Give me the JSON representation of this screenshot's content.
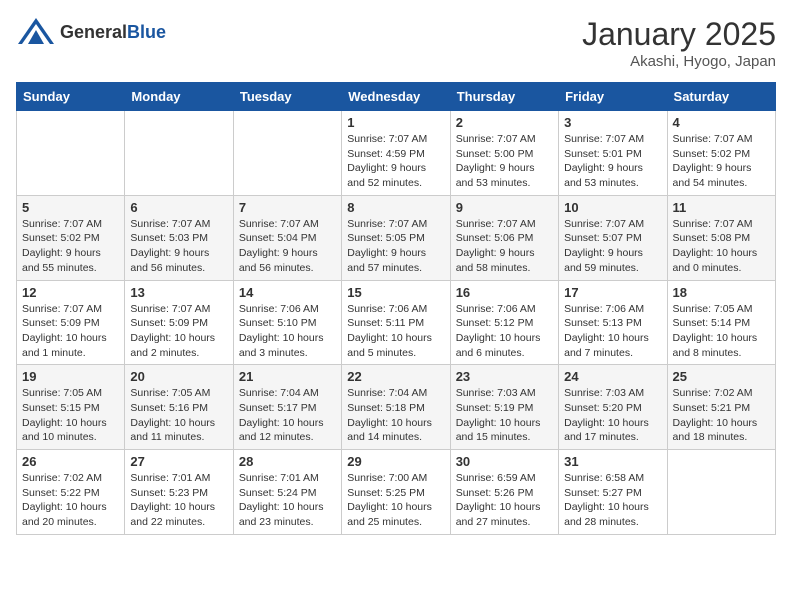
{
  "logo": {
    "general": "General",
    "blue": "Blue"
  },
  "title": "January 2025",
  "subtitle": "Akashi, Hyogo, Japan",
  "days_of_week": [
    "Sunday",
    "Monday",
    "Tuesday",
    "Wednesday",
    "Thursday",
    "Friday",
    "Saturday"
  ],
  "weeks": [
    [
      {
        "day": "",
        "info": ""
      },
      {
        "day": "",
        "info": ""
      },
      {
        "day": "",
        "info": ""
      },
      {
        "day": "1",
        "info": "Sunrise: 7:07 AM\nSunset: 4:59 PM\nDaylight: 9 hours\nand 52 minutes."
      },
      {
        "day": "2",
        "info": "Sunrise: 7:07 AM\nSunset: 5:00 PM\nDaylight: 9 hours\nand 53 minutes."
      },
      {
        "day": "3",
        "info": "Sunrise: 7:07 AM\nSunset: 5:01 PM\nDaylight: 9 hours\nand 53 minutes."
      },
      {
        "day": "4",
        "info": "Sunrise: 7:07 AM\nSunset: 5:02 PM\nDaylight: 9 hours\nand 54 minutes."
      }
    ],
    [
      {
        "day": "5",
        "info": "Sunrise: 7:07 AM\nSunset: 5:02 PM\nDaylight: 9 hours\nand 55 minutes."
      },
      {
        "day": "6",
        "info": "Sunrise: 7:07 AM\nSunset: 5:03 PM\nDaylight: 9 hours\nand 56 minutes."
      },
      {
        "day": "7",
        "info": "Sunrise: 7:07 AM\nSunset: 5:04 PM\nDaylight: 9 hours\nand 56 minutes."
      },
      {
        "day": "8",
        "info": "Sunrise: 7:07 AM\nSunset: 5:05 PM\nDaylight: 9 hours\nand 57 minutes."
      },
      {
        "day": "9",
        "info": "Sunrise: 7:07 AM\nSunset: 5:06 PM\nDaylight: 9 hours\nand 58 minutes."
      },
      {
        "day": "10",
        "info": "Sunrise: 7:07 AM\nSunset: 5:07 PM\nDaylight: 9 hours\nand 59 minutes."
      },
      {
        "day": "11",
        "info": "Sunrise: 7:07 AM\nSunset: 5:08 PM\nDaylight: 10 hours\nand 0 minutes."
      }
    ],
    [
      {
        "day": "12",
        "info": "Sunrise: 7:07 AM\nSunset: 5:09 PM\nDaylight: 10 hours\nand 1 minute."
      },
      {
        "day": "13",
        "info": "Sunrise: 7:07 AM\nSunset: 5:09 PM\nDaylight: 10 hours\nand 2 minutes."
      },
      {
        "day": "14",
        "info": "Sunrise: 7:06 AM\nSunset: 5:10 PM\nDaylight: 10 hours\nand 3 minutes."
      },
      {
        "day": "15",
        "info": "Sunrise: 7:06 AM\nSunset: 5:11 PM\nDaylight: 10 hours\nand 5 minutes."
      },
      {
        "day": "16",
        "info": "Sunrise: 7:06 AM\nSunset: 5:12 PM\nDaylight: 10 hours\nand 6 minutes."
      },
      {
        "day": "17",
        "info": "Sunrise: 7:06 AM\nSunset: 5:13 PM\nDaylight: 10 hours\nand 7 minutes."
      },
      {
        "day": "18",
        "info": "Sunrise: 7:05 AM\nSunset: 5:14 PM\nDaylight: 10 hours\nand 8 minutes."
      }
    ],
    [
      {
        "day": "19",
        "info": "Sunrise: 7:05 AM\nSunset: 5:15 PM\nDaylight: 10 hours\nand 10 minutes."
      },
      {
        "day": "20",
        "info": "Sunrise: 7:05 AM\nSunset: 5:16 PM\nDaylight: 10 hours\nand 11 minutes."
      },
      {
        "day": "21",
        "info": "Sunrise: 7:04 AM\nSunset: 5:17 PM\nDaylight: 10 hours\nand 12 minutes."
      },
      {
        "day": "22",
        "info": "Sunrise: 7:04 AM\nSunset: 5:18 PM\nDaylight: 10 hours\nand 14 minutes."
      },
      {
        "day": "23",
        "info": "Sunrise: 7:03 AM\nSunset: 5:19 PM\nDaylight: 10 hours\nand 15 minutes."
      },
      {
        "day": "24",
        "info": "Sunrise: 7:03 AM\nSunset: 5:20 PM\nDaylight: 10 hours\nand 17 minutes."
      },
      {
        "day": "25",
        "info": "Sunrise: 7:02 AM\nSunset: 5:21 PM\nDaylight: 10 hours\nand 18 minutes."
      }
    ],
    [
      {
        "day": "26",
        "info": "Sunrise: 7:02 AM\nSunset: 5:22 PM\nDaylight: 10 hours\nand 20 minutes."
      },
      {
        "day": "27",
        "info": "Sunrise: 7:01 AM\nSunset: 5:23 PM\nDaylight: 10 hours\nand 22 minutes."
      },
      {
        "day": "28",
        "info": "Sunrise: 7:01 AM\nSunset: 5:24 PM\nDaylight: 10 hours\nand 23 minutes."
      },
      {
        "day": "29",
        "info": "Sunrise: 7:00 AM\nSunset: 5:25 PM\nDaylight: 10 hours\nand 25 minutes."
      },
      {
        "day": "30",
        "info": "Sunrise: 6:59 AM\nSunset: 5:26 PM\nDaylight: 10 hours\nand 27 minutes."
      },
      {
        "day": "31",
        "info": "Sunrise: 6:58 AM\nSunset: 5:27 PM\nDaylight: 10 hours\nand 28 minutes."
      },
      {
        "day": "",
        "info": ""
      }
    ]
  ]
}
